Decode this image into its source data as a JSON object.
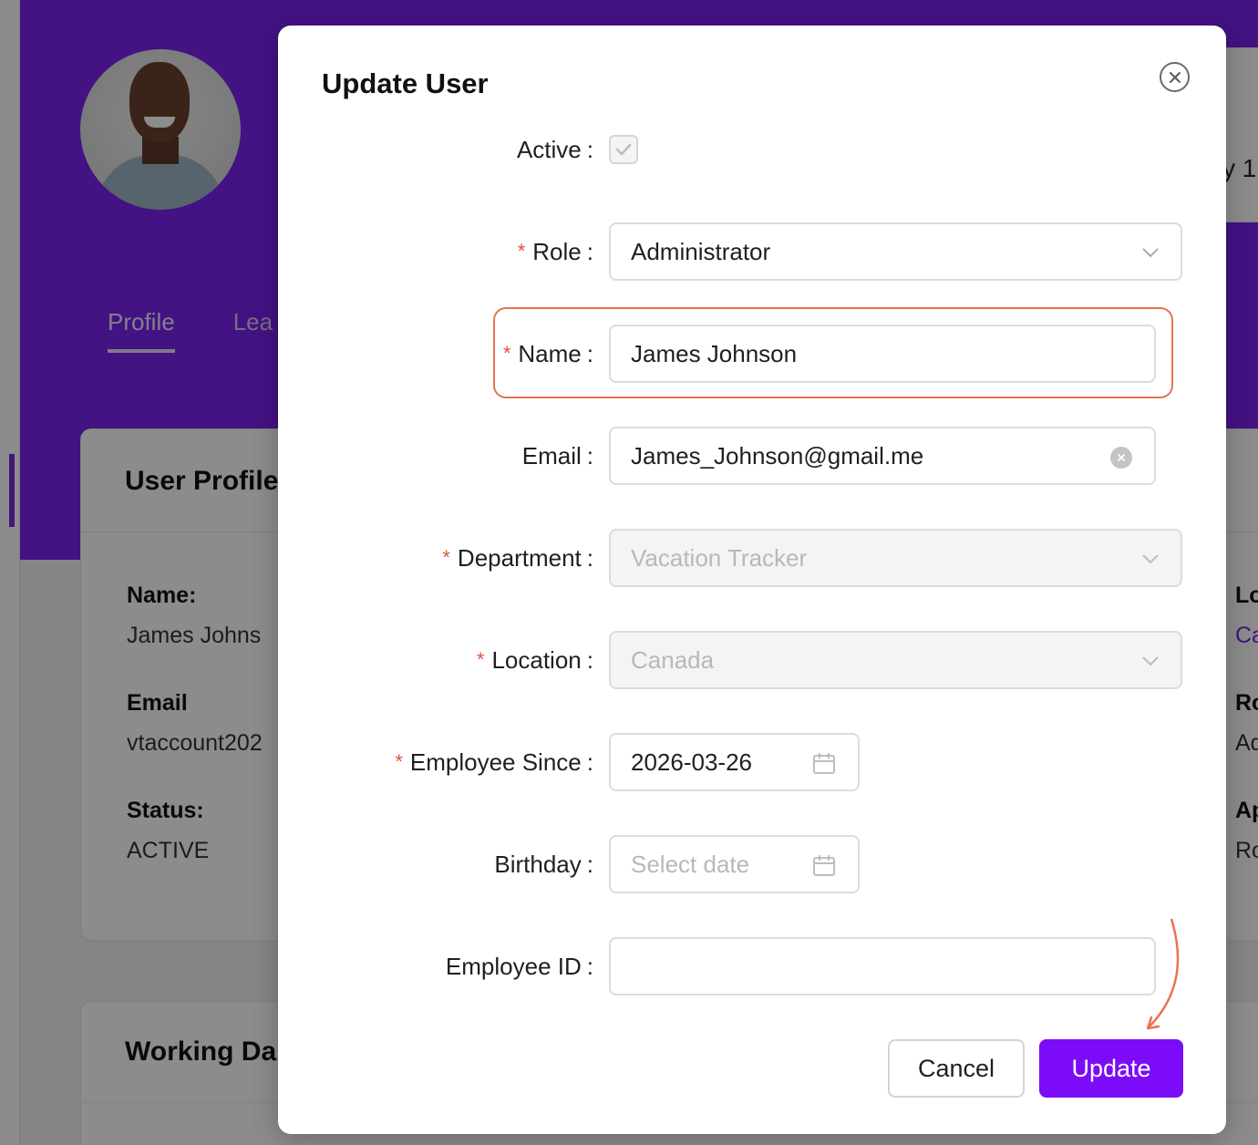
{
  "background": {
    "tabs": [
      {
        "label": "Profile",
        "active": true
      },
      {
        "label": "Lea",
        "active": false
      }
    ],
    "top_right_fragment": "y 1",
    "profile_card": {
      "title": "User Profile",
      "fields": [
        {
          "label": "Name:",
          "value": "James Johns"
        },
        {
          "label": "Email",
          "value": "vtaccount202"
        },
        {
          "label": "Status:",
          "value": "ACTIVE"
        }
      ],
      "right_fields": [
        {
          "label": "Lo",
          "value": "Ca"
        },
        {
          "label": "Ro",
          "value": "Ad"
        },
        {
          "label": "Ap",
          "value": "Ro"
        }
      ]
    },
    "working_card": {
      "title": "Working Da"
    }
  },
  "modal": {
    "title": "Update User",
    "active": {
      "label": "Active",
      "checked": true
    },
    "role": {
      "label": "Role",
      "required": true,
      "value": "Administrator"
    },
    "name": {
      "label": "Name",
      "required": true,
      "value": "James Johnson"
    },
    "email": {
      "label": "Email",
      "required": false,
      "value": "James_Johnson@gmail.me"
    },
    "department": {
      "label": "Department",
      "required": true,
      "value": "Vacation Tracker",
      "disabled": true
    },
    "location": {
      "label": "Location",
      "required": true,
      "value": "Canada",
      "disabled": true
    },
    "employee_since": {
      "label": "Employee Since",
      "required": true,
      "value": "2026-03-26"
    },
    "birthday": {
      "label": "Birthday",
      "required": false,
      "placeholder": "Select date"
    },
    "employee_id": {
      "label": "Employee ID",
      "required": false,
      "value": ""
    },
    "cancel_label": "Cancel",
    "update_label": "Update"
  },
  "colors": {
    "brand_purple": "#7a22ee",
    "primary_button": "#7c0cf7",
    "highlight": "#e87450",
    "required_star": "#e0533a"
  },
  "icons": [
    "close-icon",
    "check-icon",
    "chevron-down-icon",
    "calendar-icon",
    "clear-icon",
    "annotation-arrow"
  ]
}
